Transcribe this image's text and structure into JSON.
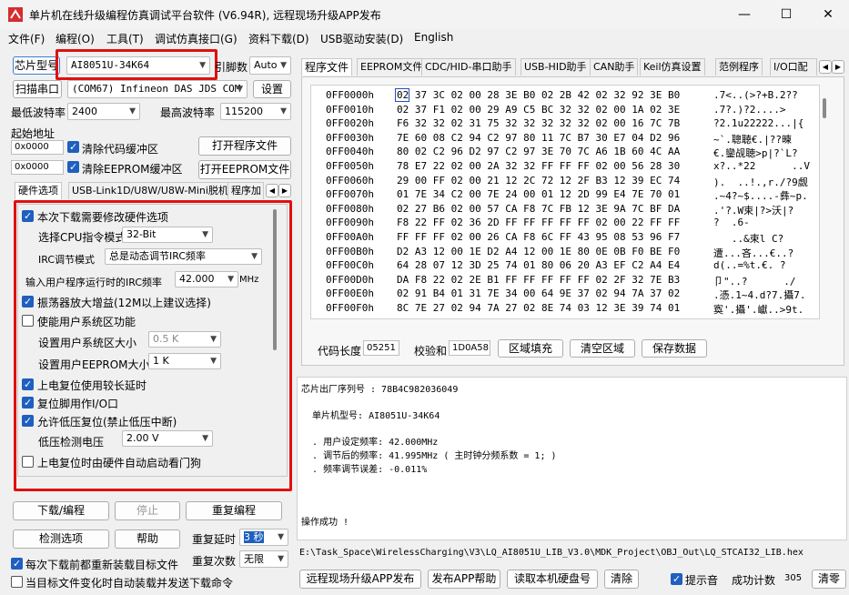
{
  "window": {
    "title": "单片机在线升级编程仿真调试平台软件 (V6.94R), 远程现场升级APP发布",
    "minimize": "—",
    "maximize": "☐",
    "close": "✕"
  },
  "menu": [
    "文件(F)",
    "编程(O)",
    "工具(T)",
    "调试仿真接口(G)",
    "资料下载(D)",
    "USB驱动安装(D)",
    "English"
  ],
  "left": {
    "chip_type_label": "芯片型号",
    "chip_type_value": "AI8051U-34K64",
    "pin_count_label": "引脚数",
    "pin_count_value": "Auto",
    "scan_port_button": "扫描串口",
    "port_value": "(COM67) Infineon DAS JDS COM",
    "settings_button": "设置",
    "min_baud_label": "最低波特率",
    "min_baud_value": "2400",
    "max_baud_label": "最高波特率",
    "max_baud_value": "115200",
    "start_addr_label": "起始地址",
    "code_addr": "0x0000",
    "clear_code_label": "清除代码缓冲区",
    "open_program_button": "打开程序文件",
    "eeprom_addr": "0x0000",
    "clear_eeprom_label": "清除EEPROM缓冲区",
    "open_eeprom_button": "打开EEPROM文件",
    "tabs": [
      "硬件选项",
      "USB-Link1D/U8W/U8W-Mini脱机",
      "程序加"
    ],
    "hw": {
      "modify_hw_label": "本次下载需要修改硬件选项",
      "cpu_mode_label": "选择CPU指令模式",
      "cpu_mode_value": "32-Bit",
      "irc_mode_label": "IRC调节模式",
      "irc_mode_value": "总是动态调节IRC频率",
      "irc_freq_label": "输入用户程序运行时的IRC频率",
      "irc_freq_value": "42.000",
      "irc_freq_unit": "MHz",
      "osc_gain_label": "振荡器放大增益(12M以上建议选择)",
      "sys_area_label": "使能用户系统区功能",
      "sys_size_label": "设置用户系统区大小",
      "sys_size_value": "0.5 K",
      "eeprom_size_label": "设置用户EEPROM大小",
      "eeprom_size_value": "1   K",
      "long_delay_label": "上电复位使用较长延时",
      "reset_io_label": "复位脚用作I/O口",
      "lvd_reset_label": "允许低压复位(禁止低压中断)",
      "lvd_voltage_label": "低压检测电压",
      "lvd_voltage_value": "2.00 V",
      "wdt_label": "上电复位时由硬件自动启动看门狗"
    },
    "download_button": "下载/编程",
    "stop_button": "停止",
    "reprogram_button": "重复编程",
    "check_options_button": "检测选项",
    "help_button": "帮助",
    "repeat_delay_label": "重复延时",
    "repeat_delay_value": "3 秒",
    "repeat_count_label": "重复次数",
    "repeat_count_value": "无限",
    "reload_label": "每次下载前都重新装载目标文件",
    "auto_send_label": "当目标文件变化时自动装载并发送下载命令"
  },
  "right": {
    "tabs": [
      "程序文件",
      "EEPROM文件",
      "CDC/HID-串口助手",
      "USB-HID助手",
      "CAN助手",
      "Keil仿真设置",
      "范例程序",
      "I/O口配"
    ],
    "hex_rows": [
      {
        "addr": "0FF0000h",
        "bytes": "02 37 3C 02 00 28 3E B0 02 2B 42 02 32 92 3E B0",
        "ascii": ".7<..(>?+B.2??"
      },
      {
        "addr": "0FF0010h",
        "bytes": "02 37 F1 02 00 29 A9 C5 BC 32 32 02 00 1A 02 3E",
        "ascii": ".7?.)?2....>"
      },
      {
        "addr": "0FF0020h",
        "bytes": "F6 32 32 02 31 75 32 32 32 32 32 02 00 16 7C 7B",
        "ascii": "?2.1u22222...|{"
      },
      {
        "addr": "0FF0030h",
        "bytes": "7E 60 08 C2 94 C2 97 80 11 7C B7 30 E7 04 D2 96",
        "ascii": "~`.聰聴€.|??暕"
      },
      {
        "addr": "0FF0040h",
        "bytes": "80 02 C2 96 D2 97 C2 97 3E 70 7C A6 1B 60 4C AA",
        "ascii": "€.鑾觇聴>p|?`L?"
      },
      {
        "addr": "0FF0050h",
        "bytes": "78 E7 22 02 00 2A 32 32 FF FF FF 02 00 56 28 30",
        "ascii": "x?..*22      ..V"
      },
      {
        "addr": "0FF0060h",
        "bytes": "29 00 FF 02 00 21 12 2C 72 12 2F B3 12 39 EC 74",
        "ascii": ").  ..!.,r./?9觑"
      },
      {
        "addr": "0FF0070h",
        "bytes": "01 7E 34 C2 00 7E 24 00 01 12 2D 99 E4 7E 70 01",
        "ascii": ".~4?~$....-彝~p."
      },
      {
        "addr": "0FF0080h",
        "bytes": "02 27 B6 02 00 57 CA F8 7C FB 12 3E 9A 7C BF DA",
        "ascii": ".'?.W束|?>沃|?"
      },
      {
        "addr": "0FF0090h",
        "bytes": "F8 22 FF 02 36 2D FF FF FF FF FF 02 00 22 FF FF",
        "ascii": "?  .6-"
      },
      {
        "addr": "0FF00A0h",
        "bytes": "FF FF FF 02 00 26 CA F8 6C FF 43 95 08 53 96 F7",
        "ascii": "   ..&束l C?"
      },
      {
        "addr": "0FF00B0h",
        "bytes": "D2 A3 12 00 1E D2 A4 12 00 1E 80 0E 0B F0 BE F0",
        "ascii": "遭...吝...€..?"
      },
      {
        "addr": "0FF00C0h",
        "bytes": "64 28 07 12 3D 25 74 01 80 06 20 A3 EF C2 A4 E4",
        "ascii": "d(..=%t.€. ?"
      },
      {
        "addr": "0FF00D0h",
        "bytes": "DA F8 22 02 2E B1 FF FF FF FF FF 02 2F 32 7E B3",
        "ascii": "卩\"..?      ./"
      },
      {
        "addr": "0FF00E0h",
        "bytes": "02 91 B4 01 31 7E 34 00 64 9E 37 02 94 7A 37 02",
        "ascii": ".憑.1~4.d?7.攝7."
      },
      {
        "addr": "0FF00F0h",
        "bytes": "8C 7E 27 02 94 7A 27 02 8E 74 03 12 3E 39 74 01",
        "ascii": "寏'.攝'.巘..>9t."
      }
    ],
    "code_len_label": "代码长度",
    "code_len_value": "05251",
    "checksum_label": "校验和",
    "checksum_value": "1D0A58",
    "fill_button": "区域填充",
    "clear_button": "清空区域",
    "save_button": "保存数据",
    "log_lines": [
      "芯片出厂序列号 : 78B4C982036049",
      "",
      "  单片机型号: AI8051U-34K64",
      "",
      "  . 用户设定频率: 42.000MHz",
      "  . 调节后的频率: 41.995MHz ( 主时钟分频系数 = 1; )",
      "  . 频率调节误差: -0.011%",
      "",
      "",
      "",
      "操作成功 !"
    ],
    "file_path": "E:\\Task_Space\\WirelessCharging\\V3\\LQ_AI8051U_LIB_V3.0\\MDK_Project\\OBJ_Out\\LQ_STCAI32_LIB.hex",
    "publish_app_button": "远程现场升级APP发布",
    "publish_help_button": "发布APP帮助",
    "read_disk_button": "读取本机硬盘号",
    "clear_log_button": "清除",
    "beep_label": "提示音",
    "success_count_label": "成功计数",
    "success_count_value": "305",
    "clear_zero_button": "清零"
  }
}
